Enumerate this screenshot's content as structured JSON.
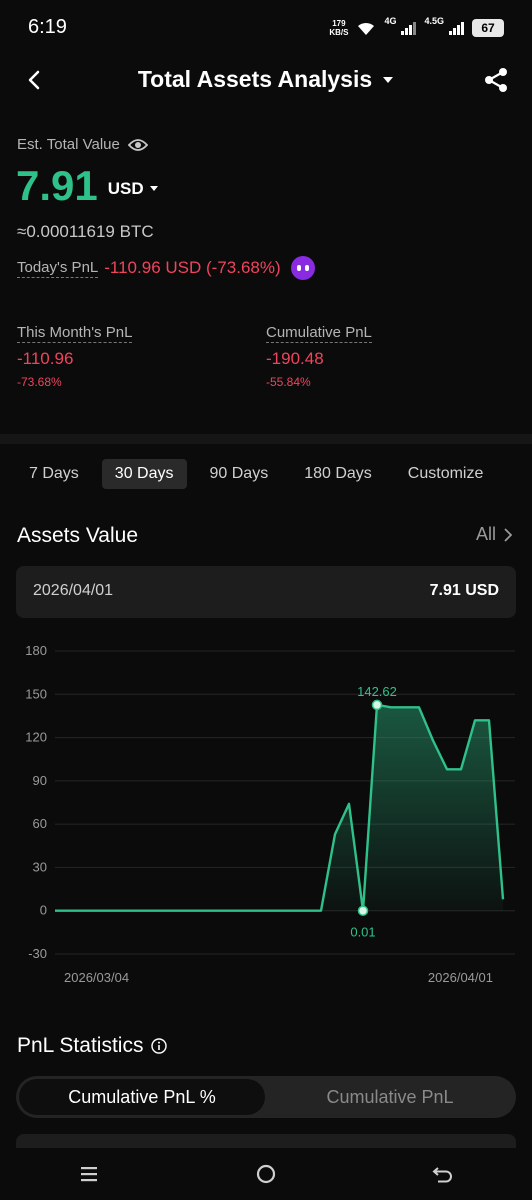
{
  "status_bar": {
    "time": "6:19",
    "net_speed_value": "179",
    "net_speed_unit": "KB/S",
    "signal_1_label": "4G",
    "signal_2_label": "4.5G",
    "battery": "67"
  },
  "header": {
    "title": "Total Assets Analysis"
  },
  "summary": {
    "est_label": "Est. Total Value",
    "total_value": "7.91",
    "currency": "USD",
    "btc_value": "≈0.00011619 BTC",
    "today_pnl_label": "Today's PnL",
    "today_pnl_value": "-110.96 USD (-73.68%)"
  },
  "pnl": {
    "month": {
      "label": "This Month's PnL",
      "value": "-110.96",
      "pct": "-73.68%"
    },
    "cumulative": {
      "label": "Cumulative PnL",
      "value": "-190.48",
      "pct": "-55.84%"
    }
  },
  "range_tabs": [
    "7 Days",
    "30 Days",
    "90 Days",
    "180 Days",
    "Customize"
  ],
  "active_range": "30 Days",
  "assets_value": {
    "title": "Assets Value",
    "all_label": "All",
    "selected_date": "2026/04/01",
    "selected_value": "7.91 USD"
  },
  "colors": {
    "accent_green": "#2fc18a",
    "negative_red": "#f0435c",
    "background": "#0b0b0b"
  },
  "chart_data": {
    "type": "area",
    "x_start_label": "2026/03/04",
    "x_end_label": "2026/04/01",
    "yticks": [
      180,
      150,
      120,
      90,
      60,
      30,
      0,
      -30
    ],
    "ylim": [
      -30,
      180
    ],
    "grid": true,
    "values": [
      0,
      0,
      0,
      0,
      0,
      0,
      0,
      0,
      0,
      0,
      0,
      0,
      0,
      0,
      0,
      0,
      0,
      0,
      0,
      0,
      53,
      74,
      0.01,
      142.62,
      141,
      141,
      141,
      118,
      98,
      98,
      132,
      132,
      7.91
    ],
    "max_label": "142.62",
    "min_label": "0.01"
  },
  "pnl_statistics": {
    "title": "PnL Statistics",
    "tab_active": "Cumulative PnL %",
    "tab_inactive": "Cumulative PnL"
  },
  "icons": [
    "back-arrow-icon",
    "caret-down-icon",
    "share-icon",
    "eye-icon",
    "chevron-right-icon",
    "info-icon",
    "nav-recent-icon",
    "nav-home-icon",
    "nav-back-icon"
  ]
}
